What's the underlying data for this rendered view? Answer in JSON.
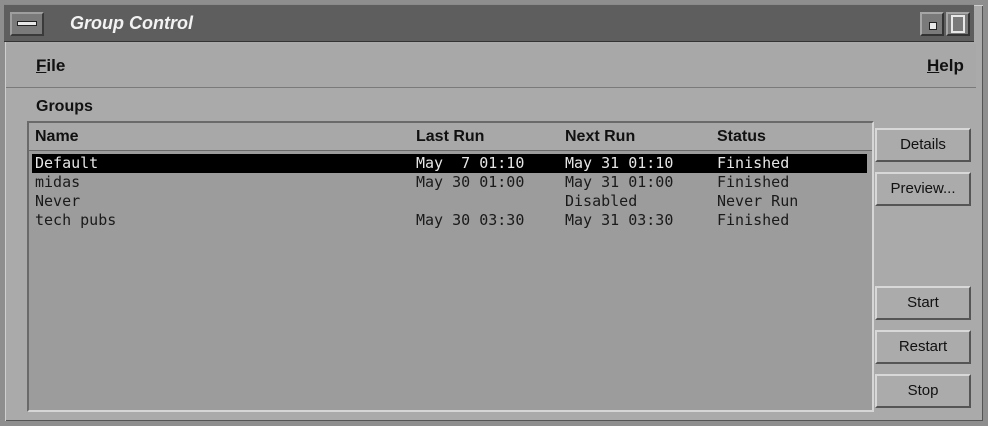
{
  "window": {
    "title": "Group Control"
  },
  "menubar": {
    "file": {
      "mnemonic": "F",
      "rest": "ile"
    },
    "help": {
      "mnemonic": "H",
      "rest": "elp"
    }
  },
  "groups": {
    "label": "Groups",
    "columns": [
      "Name",
      "Last Run",
      "Next Run",
      "Status"
    ],
    "rows": [
      {
        "name": "Default",
        "last_run": "May  7 01:10",
        "next_run": "May 31 01:10",
        "status": "Finished",
        "selected": true
      },
      {
        "name": "midas",
        "last_run": "May 30 01:00",
        "next_run": "May 31 01:00",
        "status": "Finished",
        "selected": false
      },
      {
        "name": "Never",
        "last_run": "",
        "next_run": "Disabled",
        "status": "Never Run",
        "selected": false
      },
      {
        "name": "tech pubs",
        "last_run": "May 30 03:30",
        "next_run": "May 31 03:30",
        "status": "Finished",
        "selected": false
      }
    ]
  },
  "buttons": {
    "details": "Details",
    "preview": "Preview...",
    "start": "Start",
    "restart": "Restart",
    "stop": "Stop"
  },
  "colors": {
    "title_bar": "#5e5e5e",
    "list_background": "#9c9c9c",
    "selection": "#000000"
  }
}
